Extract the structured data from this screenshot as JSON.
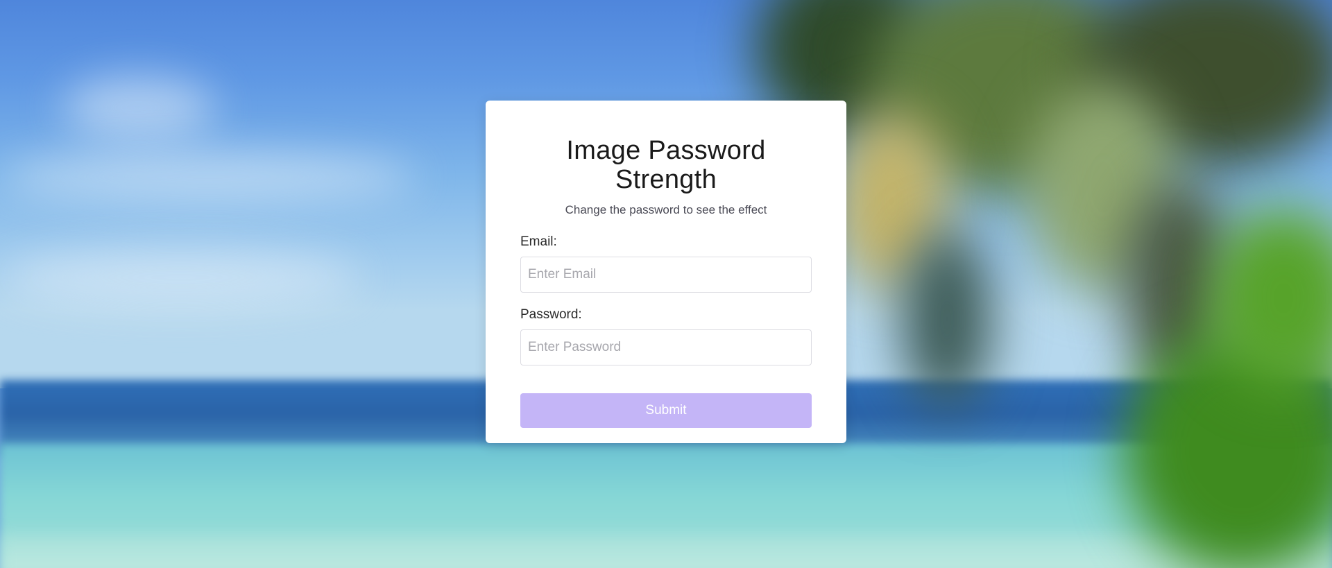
{
  "form": {
    "title": "Image Password Strength",
    "subtitle": "Change the password to see the effect",
    "email_label": "Email:",
    "email_placeholder": "Enter Email",
    "email_value": "",
    "password_label": "Password:",
    "password_placeholder": "Enter Password",
    "password_value": "",
    "submit_label": "Submit"
  },
  "colors": {
    "card_background": "#ffffff",
    "submit_button": "#c4b5f7",
    "submit_text": "#ffffff",
    "input_border": "#dcdce2"
  },
  "background": {
    "description_icon": "blurred-beach-image"
  }
}
